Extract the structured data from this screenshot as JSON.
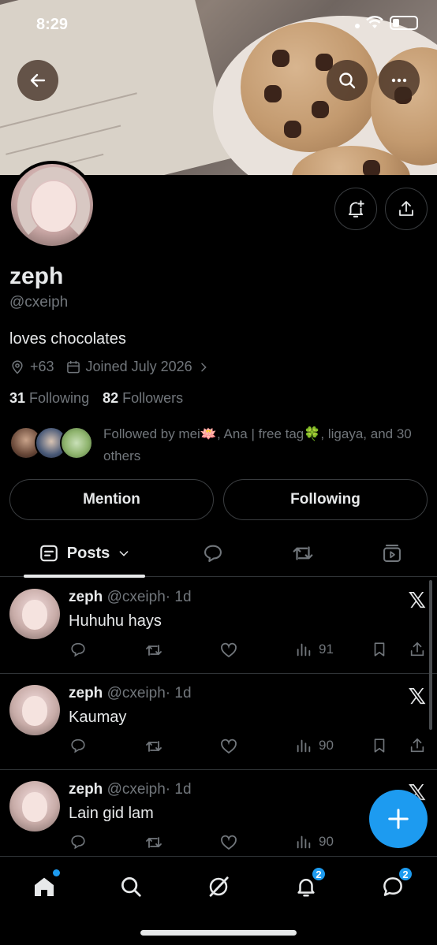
{
  "status_bar": {
    "time": "8:29"
  },
  "colors": {
    "accent": "#1d9bf0",
    "text_primary": "#e7e9ea",
    "text_secondary": "#71767b",
    "divider": "#2f3336",
    "background": "#000000"
  },
  "header": {
    "back_icon": "arrow-left-icon",
    "search_icon": "search-icon",
    "more_icon": "more-horizontal-icon"
  },
  "profile": {
    "name": "zeph",
    "handle": "@cxeiph",
    "bio": "loves chocolates",
    "location": "+63",
    "joined": "Joined July 2026",
    "following_count": "31",
    "following_label": "Following",
    "followers_count": "82",
    "followers_label": "Followers",
    "followed_by": "Followed by mei🪷, Ana | free tag🍀, ligaya, and 30 others"
  },
  "actions": {
    "mention_label": "Mention",
    "following_label": "Following"
  },
  "tabs": {
    "posts_label": "Posts"
  },
  "posts": [
    {
      "name": "zeph",
      "handle": "@cxeiph",
      "time": "· 1d",
      "text": "Huhuhu hays",
      "views": "91"
    },
    {
      "name": "zeph",
      "handle": "@cxeiph",
      "time": "· 1d",
      "text": "Kaumay",
      "views": "90"
    },
    {
      "name": "zeph",
      "handle": "@cxeiph",
      "time": "· 1d",
      "text": "Lain gid lam",
      "views": "90"
    }
  ],
  "bottom_nav": {
    "notifications_badge": "2",
    "messages_badge": "2"
  }
}
